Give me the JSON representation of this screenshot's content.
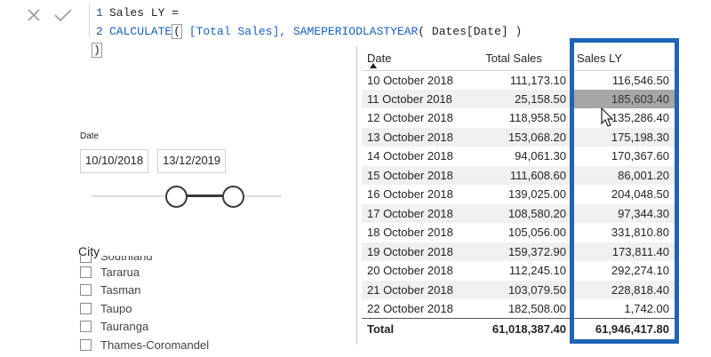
{
  "formula": {
    "line1_num": "1",
    "line1_text": "Sales LY =",
    "line2_num": "2",
    "line2_fn": "CALCULATE",
    "line2_open": "(",
    "line2_args": " [Total Sales], ",
    "line2_fn2": "SAMEPERIODLASTYEAR",
    "line2_args2": "( Dates[Date] ) ",
    "line2_close": ")"
  },
  "date_slicer": {
    "title": "Date",
    "start": "10/10/2018",
    "end": "13/12/2019",
    "range_fraction": [
      0.45,
      0.72
    ]
  },
  "city_slicer": {
    "title": "City",
    "items": [
      "Southland",
      "Tararua",
      "Tasman",
      "Taupo",
      "Tauranga",
      "Thames-Coromandel"
    ]
  },
  "table": {
    "headers": [
      "Date",
      "Total Sales",
      "Sales LY"
    ],
    "rows": [
      [
        "10 October 2018",
        "111,173.10",
        "116,546.50"
      ],
      [
        "11 October 2018",
        "25,158.50",
        "185,603.40"
      ],
      [
        "12 October 2018",
        "118,958.50",
        "135,286.40"
      ],
      [
        "13 October 2018",
        "153,068.20",
        "175,198.30"
      ],
      [
        "14 October 2018",
        "94,061.30",
        "170,367.60"
      ],
      [
        "15 October 2018",
        "111,608.60",
        "86,001.20"
      ],
      [
        "16 October 2018",
        "139,025.00",
        "204,048.50"
      ],
      [
        "17 October 2018",
        "108,580.20",
        "97,344.30"
      ],
      [
        "18 October 2018",
        "105,056.00",
        "331,810.80"
      ],
      [
        "19 October 2018",
        "159,372.90",
        "173,811.40"
      ],
      [
        "20 October 2018",
        "112,245.10",
        "292,274.10"
      ],
      [
        "21 October 2018",
        "103,079.50",
        "228,818.40"
      ],
      [
        "22 October 2018",
        "182,508.00",
        "1,742.00"
      ]
    ],
    "total": [
      "Total",
      "61,018,387.40",
      "61,946,417.80"
    ]
  },
  "colors": {
    "highlight_frame": "#1f64b4",
    "selected_cell": "#a6a6a6"
  }
}
